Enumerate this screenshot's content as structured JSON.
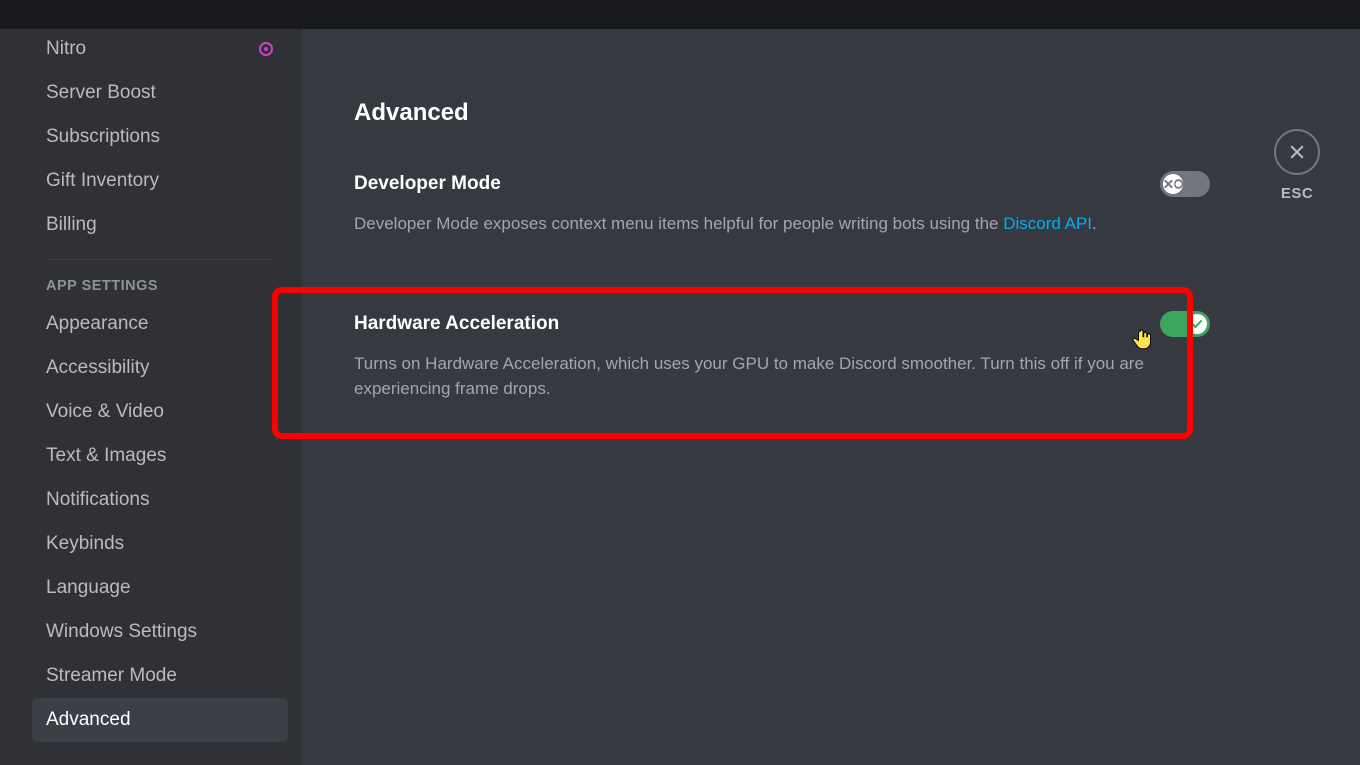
{
  "sidebar": {
    "billing_group": [
      {
        "label": "Nitro",
        "badge": true
      },
      {
        "label": "Server Boost"
      },
      {
        "label": "Subscriptions"
      },
      {
        "label": "Gift Inventory"
      },
      {
        "label": "Billing"
      }
    ],
    "app_header": "APP SETTINGS",
    "app_group": [
      {
        "label": "Appearance"
      },
      {
        "label": "Accessibility"
      },
      {
        "label": "Voice & Video"
      },
      {
        "label": "Text & Images"
      },
      {
        "label": "Notifications"
      },
      {
        "label": "Keybinds"
      },
      {
        "label": "Language"
      },
      {
        "label": "Windows Settings"
      },
      {
        "label": "Streamer Mode"
      },
      {
        "label": "Advanced",
        "active": true
      }
    ]
  },
  "page": {
    "title": "Advanced",
    "close_label": "ESC",
    "settings": {
      "dev_mode": {
        "title": "Developer Mode",
        "desc_pre": "Developer Mode exposes context menu items helpful for people writing bots using the ",
        "link_text": "Discord API",
        "desc_post": ".",
        "enabled": false
      },
      "hw_accel": {
        "title": "Hardware Acceleration",
        "desc": "Turns on Hardware Acceleration, which uses your GPU to make Discord smoother. Turn this off if you are experiencing frame drops.",
        "enabled": true
      }
    }
  }
}
